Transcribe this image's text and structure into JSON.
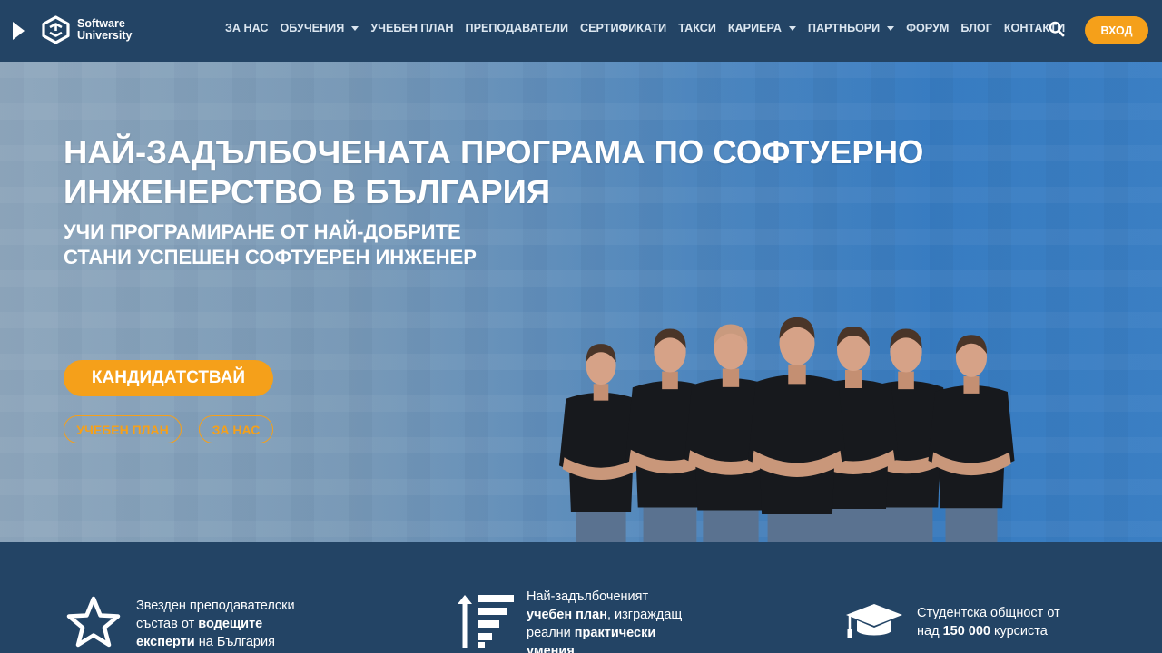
{
  "header": {
    "logo": {
      "line1": "Software",
      "line2": "University"
    },
    "nav": [
      {
        "label": "ЗА НАС",
        "dropdown": false
      },
      {
        "label": "ОБУЧЕНИЯ",
        "dropdown": true
      },
      {
        "label": "УЧЕБЕН ПЛАН",
        "dropdown": false
      },
      {
        "label": "ПРЕПОДАВАТЕЛИ",
        "dropdown": false
      },
      {
        "label": "СЕРТИФИКАТИ",
        "dropdown": false
      },
      {
        "label": "ТАКСИ",
        "dropdown": false
      },
      {
        "label": "КАРИЕРА",
        "dropdown": true
      },
      {
        "label": "ПАРТНЬОРИ",
        "dropdown": true
      },
      {
        "label": "ФОРУМ",
        "dropdown": false
      },
      {
        "label": "БЛОГ",
        "dropdown": false
      },
      {
        "label": "КОНТАКТИ",
        "dropdown": false
      }
    ],
    "login_label": "ВХОД"
  },
  "hero": {
    "title_line1": "НАЙ-ЗАДЪЛБОЧЕНАТА ПРОГРАМА ПО СОФТУЕРНО",
    "title_line2": "ИНЖЕНЕРСТВО В БЪЛГАРИЯ",
    "sub_line1": "УЧИ ПРОГРАМИРАНЕ ОТ НАЙ-ДОБРИТЕ",
    "sub_line2": "СТАНИ УСПЕШЕН СОФТУЕРЕН ИНЖЕНЕР",
    "apply_label": "КАНДИДАТСТВАЙ",
    "curriculum_label": "УЧЕБЕН ПЛАН",
    "about_label": "ЗА НАС"
  },
  "features": [
    {
      "icon": "star-icon",
      "parts": [
        [
          "Звезден преподавателски",
          false
        ],
        [
          "\n",
          false
        ],
        [
          "състав от ",
          false
        ],
        [
          "водещите",
          true
        ],
        [
          "\n",
          false
        ],
        [
          "експерти",
          true
        ],
        [
          " на България",
          false
        ]
      ]
    },
    {
      "icon": "curriculum-icon",
      "parts": [
        [
          "Най-задълбоченият",
          false
        ],
        [
          "\n",
          false
        ],
        [
          "учебен план",
          true
        ],
        [
          ", изграждащ",
          false
        ],
        [
          "\n",
          false
        ],
        [
          "реални ",
          false
        ],
        [
          "практически",
          true
        ],
        [
          "\n",
          false
        ],
        [
          "умения",
          true
        ]
      ]
    },
    {
      "icon": "graduation-cap-icon",
      "parts": [
        [
          "Студентска общност от",
          false
        ],
        [
          "\n",
          false
        ],
        [
          "над ",
          false
        ],
        [
          "150 000",
          true
        ],
        [
          " курсиста",
          false
        ]
      ]
    }
  ],
  "colors": {
    "navy": "#234465",
    "accent": "#f5a01a",
    "hero_blue": "#3f85c9"
  }
}
